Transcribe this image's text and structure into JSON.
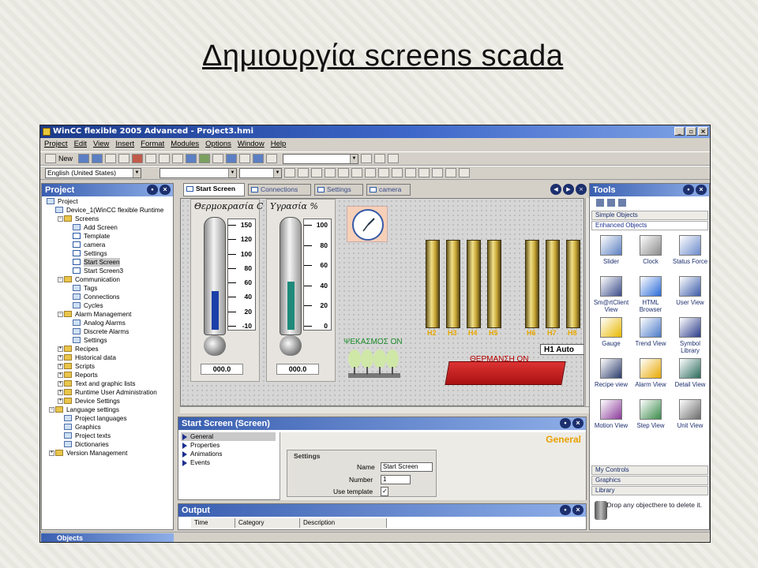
{
  "slide": {
    "title": "Δημιουργία screens scada"
  },
  "window": {
    "title": "WinCC flexible 2005 Advanced - Project3.hmi",
    "buttons": [
      "_",
      "▫",
      "×"
    ]
  },
  "menu": [
    "Project",
    "Edit",
    "View",
    "Insert",
    "Format",
    "Modules",
    "Options",
    "Window",
    "Help"
  ],
  "toolbar": {
    "new_label": "New",
    "language_value": "English (United States)"
  },
  "project_panel": {
    "title": "Project",
    "tree": [
      {
        "label": "Project",
        "level": 0,
        "icon": "project-icon"
      },
      {
        "label": "Device_1(WinCC flexible Runtime",
        "level": 1,
        "icon": "device-icon"
      },
      {
        "label": "Screens",
        "level": 2,
        "icon": "folder-icon"
      },
      {
        "label": "Add Screen",
        "level": 3,
        "icon": "add-icon"
      },
      {
        "label": "Template",
        "level": 3,
        "icon": "screen-icon"
      },
      {
        "label": "camera",
        "level": 3,
        "icon": "screen-icon"
      },
      {
        "label": "Settings",
        "level": 3,
        "icon": "screen-icon"
      },
      {
        "label": "Start Screen",
        "level": 3,
        "icon": "screen-icon",
        "selected": true
      },
      {
        "label": "Start Screen3",
        "level": 3,
        "icon": "screen-icon"
      },
      {
        "label": "Communication",
        "level": 2,
        "icon": "folder-icon"
      },
      {
        "label": "Tags",
        "level": 3,
        "icon": "tag-icon"
      },
      {
        "label": "Connections",
        "level": 3,
        "icon": "connection-icon"
      },
      {
        "label": "Cycles",
        "level": 3,
        "icon": "cycle-icon"
      },
      {
        "label": "Alarm Management",
        "level": 2,
        "icon": "folder-icon"
      },
      {
        "label": "Analog Alarms",
        "level": 3,
        "icon": "alarm-icon"
      },
      {
        "label": "Discrete Alarms",
        "level": 3,
        "icon": "alarm-icon"
      },
      {
        "label": "Settings",
        "level": 3,
        "icon": "settings-icon"
      },
      {
        "label": "Recipes",
        "level": 2,
        "icon": "folder-icon"
      },
      {
        "label": "Historical data",
        "level": 2,
        "icon": "folder-icon"
      },
      {
        "label": "Scripts",
        "level": 2,
        "icon": "folder-icon"
      },
      {
        "label": "Reports",
        "level": 2,
        "icon": "folder-icon"
      },
      {
        "label": "Text and graphic lists",
        "level": 2,
        "icon": "folder-icon"
      },
      {
        "label": "Runtime User Administration",
        "level": 2,
        "icon": "folder-icon"
      },
      {
        "label": "Device Settings",
        "level": 2,
        "icon": "folder-icon"
      },
      {
        "label": "Language settings",
        "level": 1,
        "icon": "folder-icon"
      },
      {
        "label": "Project languages",
        "level": 2,
        "icon": "language-icon"
      },
      {
        "label": "Graphics",
        "level": 2,
        "icon": "graphics-icon"
      },
      {
        "label": "Project texts",
        "level": 2,
        "icon": "text-icon"
      },
      {
        "label": "Dictionaries",
        "level": 2,
        "icon": "dictionary-icon"
      },
      {
        "label": "Version Management",
        "level": 1,
        "icon": "folder-icon"
      }
    ]
  },
  "editor_tabs": [
    {
      "label": "Start Screen",
      "active": true
    },
    {
      "label": "Connections",
      "active": false
    },
    {
      "label": "Settings",
      "active": false
    },
    {
      "label": "camera",
      "active": false
    }
  ],
  "screen": {
    "temperature": {
      "label": "Θερμοκρασία C",
      "scale": [
        "150",
        "120",
        "100",
        "80",
        "60",
        "40",
        "20",
        "-10"
      ],
      "value": "000.0",
      "level": 0.36
    },
    "humidity": {
      "label": "Υγρασία %",
      "scale": [
        "100",
        "80",
        "60",
        "40",
        "20",
        "0"
      ],
      "value": "000.0",
      "level": 0.45
    },
    "heater_labels": [
      "H2",
      "H3",
      "H4",
      "H5",
      "H6",
      "H7",
      "H8"
    ],
    "spray_label": "ΨΕΚΑΣΜΟΣ ΟΝ",
    "heating_label": "ΘΕΡΜΑΝΣΗ ΟΝ",
    "h1_field": "H1 Auto"
  },
  "properties_panel": {
    "title": "Start Screen (Screen)",
    "categories": [
      "General",
      "Properties",
      "Animations",
      "Events"
    ],
    "section_title": "General",
    "group_title": "Settings",
    "name_label": "Name",
    "name_value": "Start Screen",
    "number_label": "Number",
    "number_value": "1",
    "template_label": "Use template",
    "template_checked": true
  },
  "output_panel": {
    "title": "Output",
    "columns": [
      "Time",
      "Category",
      "Description"
    ]
  },
  "tools_panel": {
    "title": "Tools",
    "sections_top": [
      "Simple Objects",
      "Enhanced Objects"
    ],
    "items": [
      {
        "label": "Slider",
        "icon": "slider-icon"
      },
      {
        "label": "Clock",
        "icon": "clock-icon"
      },
      {
        "label": "Status Force",
        "icon": "status-force-icon"
      },
      {
        "label": "Sm@rtClient View",
        "icon": "smartclient-icon"
      },
      {
        "label": "HTML Browser",
        "icon": "browser-icon"
      },
      {
        "label": "User View",
        "icon": "user-view-icon"
      },
      {
        "label": "Gauge",
        "icon": "gauge-icon"
      },
      {
        "label": "Trend View",
        "icon": "trend-icon"
      },
      {
        "label": "Symbol Library",
        "icon": "symbol-library-icon"
      },
      {
        "label": "Recipe view",
        "icon": "recipe-icon"
      },
      {
        "label": "Alarm View",
        "icon": "alarm-view-icon"
      },
      {
        "label": "Detail View",
        "icon": "detail-view-icon"
      },
      {
        "label": "Motion View",
        "icon": "motion-view-icon"
      },
      {
        "label": "Step View",
        "icon": "step-view-icon"
      },
      {
        "label": "Unit View",
        "icon": "unit-view-icon"
      }
    ],
    "sections_bottom": [
      "My Controls",
      "Graphics",
      "Library"
    ],
    "drop_hint": "Drop any objecthere to delete it."
  },
  "objects_tab": "Objects"
}
